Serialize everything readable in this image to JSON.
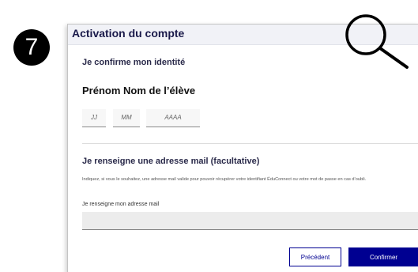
{
  "step": {
    "number": "7"
  },
  "panel": {
    "title": "Activation du compte"
  },
  "identity": {
    "heading": "Je confirme mon identité",
    "student_name": "Prénom Nom de l’élève",
    "day_placeholder": "JJ",
    "month_placeholder": "MM",
    "year_placeholder": "AAAA"
  },
  "email": {
    "heading": "Je renseigne une adresse mail (facultative)",
    "help_text": "Indiquez, si vous le souhaitez, une adresse mail valide pour pouvoir récupérer votre identifiant ÉduConnect ou votre mot de passe en cas d’oubli.",
    "label": "Je renseigne mon adresse mail",
    "value": ""
  },
  "actions": {
    "previous_label": "Précédent",
    "confirm_label": "Confirmer"
  },
  "icons": {
    "zoom": "magnifier-icon"
  },
  "colors": {
    "primary": "#000091",
    "header_background": "#f1f2f7",
    "input_background": "#ececec"
  }
}
